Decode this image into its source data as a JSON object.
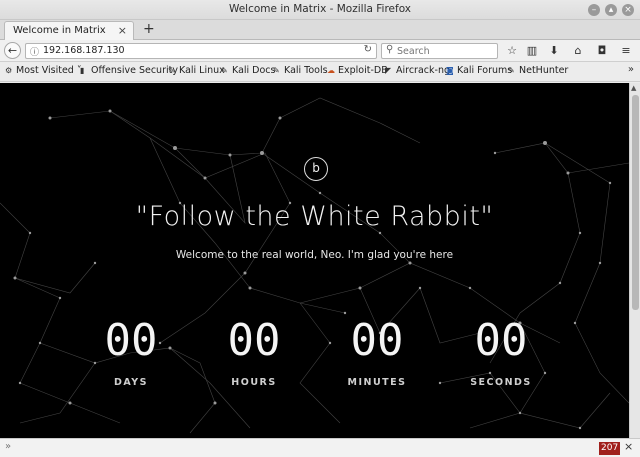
{
  "window": {
    "title": "Welcome in Matrix - Mozilla Firefox",
    "controls": [
      "minimize-icon",
      "maximize-icon",
      "close-icon"
    ]
  },
  "tabs": [
    {
      "label": "Welcome in Matrix",
      "close": "×"
    }
  ],
  "newtab_label": "+",
  "nav": {
    "url": "192.168.187.130",
    "search_placeholder": "Search",
    "icons": [
      "back-arrow-icon",
      "info-icon",
      "reload-icon",
      "search-icon",
      "bookmark-star-icon",
      "library-icon",
      "download-icon",
      "home-icon",
      "pocket-icon",
      "menu-icon"
    ]
  },
  "bookmarks": {
    "items": [
      {
        "label": "Most Visited",
        "icon": "gear-icon"
      },
      {
        "label": "Offensive Security",
        "icon": "offsec-icon"
      },
      {
        "label": "Kali Linux",
        "icon": "kali-icon"
      },
      {
        "label": "Kali Docs",
        "icon": "kali-icon"
      },
      {
        "label": "Kali Tools",
        "icon": "kali-icon"
      },
      {
        "label": "Exploit-DB",
        "icon": "exploitdb-icon"
      },
      {
        "label": "Aircrack-ng",
        "icon": "aircrack-icon"
      },
      {
        "label": "Kali Forums",
        "icon": "kali-forums-icon"
      },
      {
        "label": "NetHunter",
        "icon": "kali-icon"
      }
    ],
    "more": "»"
  },
  "page": {
    "logo": "b",
    "heading": "\"Follow the White Rabbit\"",
    "subheading": "Welcome to the real world, Neo. I'm glad you're here",
    "countdown": [
      {
        "value": "00",
        "label": "DAYS"
      },
      {
        "value": "00",
        "label": "HOURS"
      },
      {
        "value": "00",
        "label": "MINUTES"
      },
      {
        "value": "00",
        "label": "SECONDS"
      }
    ],
    "background_color": "#000000",
    "text_color": "#f2f2f2"
  },
  "bottombar": {
    "chevron": "»",
    "badge": "207",
    "badge_color": "#a0201c",
    "close": "×"
  }
}
